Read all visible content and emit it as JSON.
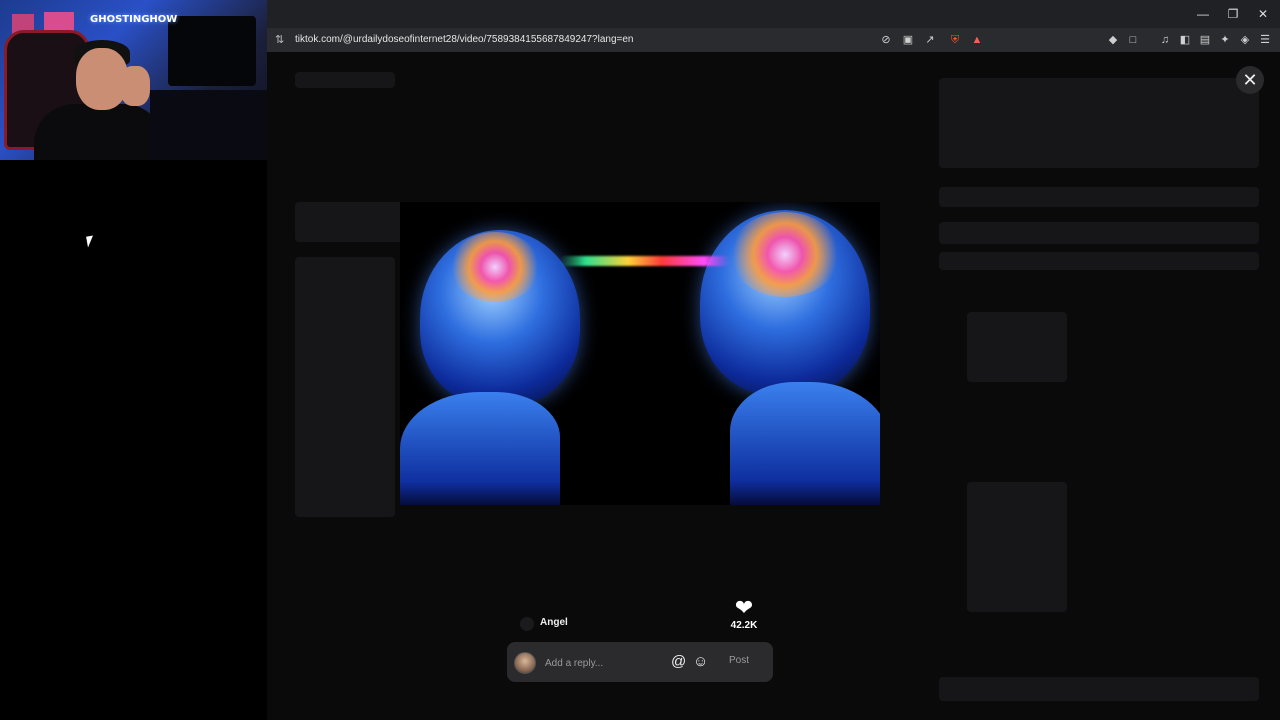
{
  "webcam": {
    "overlay_name": "GHOSTINGHOW"
  },
  "browser": {
    "url": "tiktok.com/@urdailydoseofinternet28/video/7589384155687849247?lang=en",
    "window_controls": [
      "minimize-icon",
      "restore-icon",
      "close-icon"
    ],
    "toolbar_icons": [
      "site-info-icon",
      "no-tracking-icon",
      "cast-icon",
      "share-icon",
      "brave-shield-icon",
      "brave-rewards-icon",
      "extensions-icon",
      "screenshot-icon",
      "music-icon",
      "sidebar-icon",
      "wallet-icon",
      "leo-ai-icon",
      "vpn-icon",
      "menu-icon"
    ]
  },
  "modal": {
    "close_glyph": "✕",
    "reply_to": {
      "name": "Angel"
    },
    "like": {
      "count": "42.2K"
    },
    "reply_input": {
      "placeholder": "Add a reply...",
      "value": ""
    },
    "at_glyph": "@",
    "emoji_glyph": "☺",
    "post_label": "Post"
  },
  "colors": {
    "accent": "#fe2c55",
    "brave": "#fb542b",
    "modal_bg": "#0a0a0b",
    "input_bg": "#2b2b2e"
  }
}
